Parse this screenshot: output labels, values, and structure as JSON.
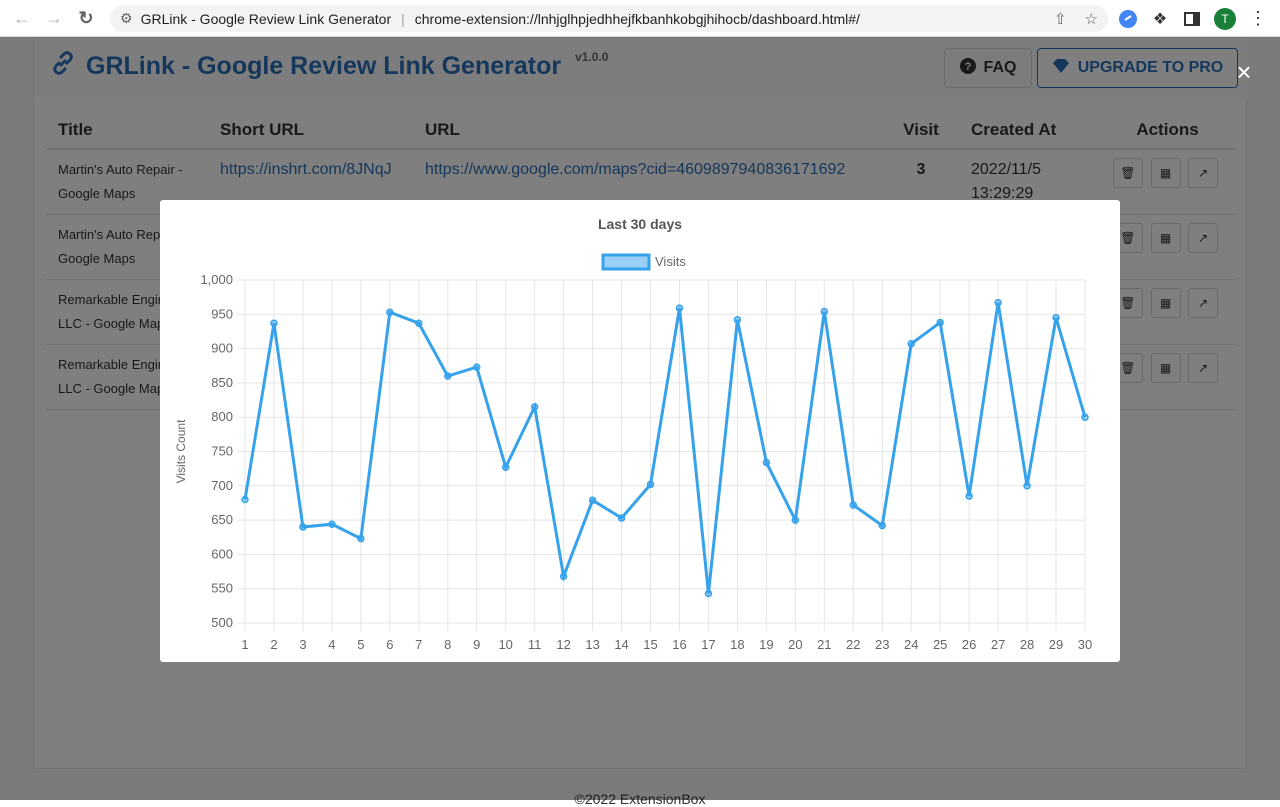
{
  "browser": {
    "tab_title": "GRLink - Google Review Link Generator",
    "url": "chrome-extension://lnhjglhpjedhhejfkbanhkobgjhihocb/dashboard.html#/",
    "profile_initial": "T"
  },
  "app": {
    "title": "GRLink - Google Review Link Generator",
    "version": "v1.0.0",
    "faq_label": "FAQ",
    "upgrade_label": "UPGRADE TO PRO",
    "table": {
      "headers": [
        "Title",
        "Short URL",
        "URL",
        "Visit",
        "Created At",
        "Actions"
      ],
      "rows": [
        {
          "title_line1": "Martin's Auto Repair -",
          "title_line2": "Google Maps",
          "short_url": "https://inshrt.com/8JNqJ",
          "url": "https://www.google.com/maps?cid=4609897940836171692",
          "visit": "3",
          "created_line1": "2022/11/5",
          "created_line2": "13:29:29"
        },
        {
          "title_line1": "Martin's Auto Repa",
          "title_line2": "Google Maps",
          "short_url": "",
          "url": "",
          "visit": "",
          "created_line1": "",
          "created_line2": ""
        },
        {
          "title_line1": "Remarkable Engin",
          "title_line2": "LLC - Google Map",
          "short_url": "",
          "url": "",
          "visit": "",
          "created_line1": "",
          "created_line2": ""
        },
        {
          "title_line1": "Remarkable Engin",
          "title_line2": "LLC - Google Map",
          "short_url": "",
          "url": "",
          "visit": "",
          "created_line1": "",
          "created_line2": ""
        }
      ]
    },
    "footer": "©2022 ExtensionBox"
  },
  "modal": {
    "close_label": "×"
  },
  "chart_data": {
    "type": "line",
    "title": "Last 30 days",
    "xlabel": "",
    "ylabel": "Visits Count",
    "ylim": [
      500,
      1000
    ],
    "yticks": [
      500,
      550,
      600,
      650,
      700,
      750,
      800,
      850,
      900,
      950,
      1000
    ],
    "ytick_labels": [
      "500",
      "550",
      "600",
      "650",
      "700",
      "750",
      "800",
      "850",
      "900",
      "950",
      "1,000"
    ],
    "categories": [
      "1",
      "2",
      "3",
      "4",
      "5",
      "6",
      "7",
      "8",
      "9",
      "10",
      "11",
      "12",
      "13",
      "14",
      "15",
      "16",
      "17",
      "18",
      "19",
      "20",
      "21",
      "22",
      "23",
      "24",
      "25",
      "26",
      "27",
      "28",
      "29",
      "30"
    ],
    "series": [
      {
        "name": "Visits",
        "color": "#36a2eb",
        "values": [
          680,
          937,
          640,
          644,
          623,
          953,
          937,
          860,
          873,
          727,
          815,
          568,
          679,
          653,
          702,
          959,
          543,
          942,
          734,
          650,
          954,
          672,
          642,
          907,
          938,
          685,
          967,
          700,
          945,
          800
        ]
      }
    ],
    "legend_position": "top",
    "grid": true
  }
}
